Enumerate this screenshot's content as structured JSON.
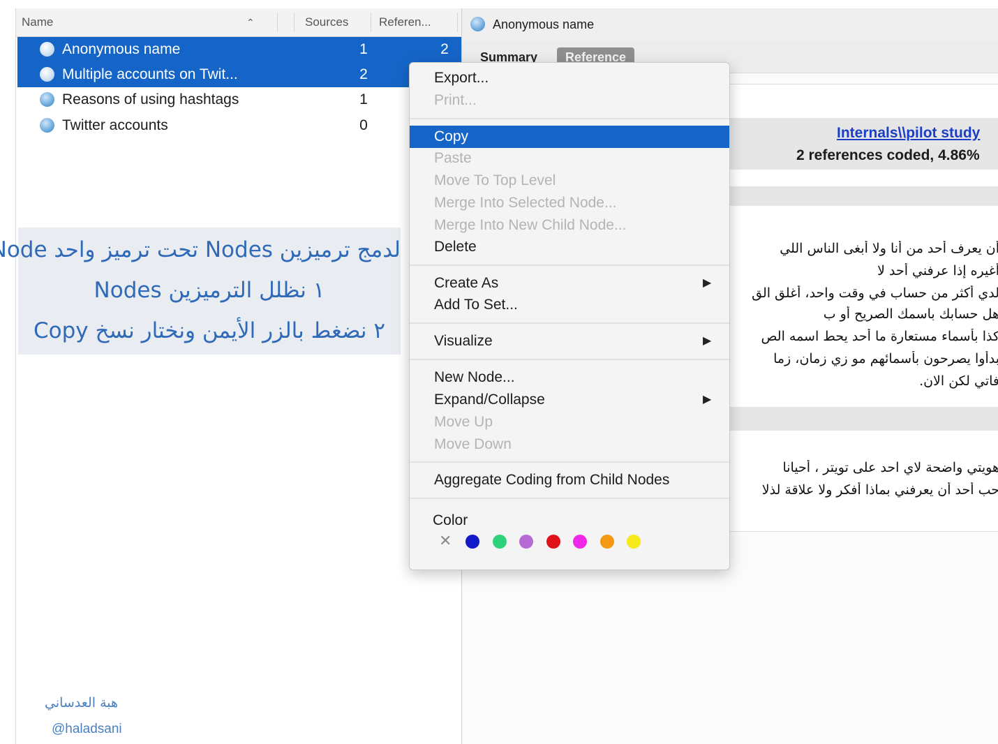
{
  "tree": {
    "headers": {
      "name": "Name",
      "sources": "Sources",
      "references": "Referen..."
    },
    "rows": [
      {
        "name": "Anonymous name",
        "sources": "1",
        "references": "2",
        "selected": true
      },
      {
        "name": "Multiple accounts on Twit...",
        "sources": "2",
        "references": "",
        "selected": true
      },
      {
        "name": "Reasons of using hashtags",
        "sources": "1",
        "references": "",
        "selected": false
      },
      {
        "name": "Twitter accounts",
        "sources": "0",
        "references": "",
        "selected": false
      }
    ]
  },
  "annotation": {
    "line1": "لدمج ترميزين Nodes تحت ترميز واحد Node",
    "line2": "١ نظلل الترميزين Nodes",
    "line3": "٢ نضغط بالزر الأيمن ونختار نسخ Copy",
    "author_name": "هبة العدساني",
    "author_handle": "@haladsani"
  },
  "detail": {
    "title": "Anonymous name",
    "tabs": {
      "summary": "Summary",
      "reference": "Reference"
    },
    "source_link": "Internals\\\\pilot study",
    "coded_summary": "2 references coded, 4.86%",
    "paragraph1": [
      "أن يعرف أحد من أنا ولا أبغى الناس اللي",
      "أغيره إذا عرفني أحد لا",
      "لدي أكثر من حساب في وقت واحد، أغلق الق",
      "هل حسابك باسمك الصريح أو ب",
      "كذا بأسماء مستعارة ما أحد يحط اسمه الص",
      "بدأوا يصرحون بأسمائهم مو زي زمان، زما",
      "فاتي لكن الان."
    ],
    "paragraph2": [
      "هويتي واضحة لاي احد على تويتر ، أحيانا",
      "حب أحد أن يعرفني بماذا أفكر ولا علاقة لذلا"
    ]
  },
  "context_menu": {
    "items": [
      {
        "label": "Export...",
        "enabled": true
      },
      {
        "label": "Print...",
        "enabled": false
      },
      {
        "label": "Copy",
        "enabled": true,
        "highlighted": true
      },
      {
        "label": "Paste",
        "enabled": false
      },
      {
        "label": "Move To Top Level",
        "enabled": false
      },
      {
        "label": "Merge Into Selected Node...",
        "enabled": false
      },
      {
        "label": "Merge Into New Child Node...",
        "enabled": false
      },
      {
        "label": "Delete",
        "enabled": true
      },
      {
        "label": "Create As",
        "enabled": true,
        "submenu": true
      },
      {
        "label": "Add To Set...",
        "enabled": true
      },
      {
        "label": "Visualize",
        "enabled": true,
        "submenu": true
      },
      {
        "label": "New Node...",
        "enabled": true
      },
      {
        "label": "Expand/Collapse",
        "enabled": true,
        "submenu": true
      },
      {
        "label": "Move Up",
        "enabled": false
      },
      {
        "label": "Move Down",
        "enabled": false
      },
      {
        "label": "Aggregate Coding from Child Nodes",
        "enabled": true
      }
    ],
    "color_label": "Color",
    "colors": [
      "#1219c9",
      "#2fd17a",
      "#b56ad6",
      "#e0131a",
      "#ee28e6",
      "#f39a12",
      "#f5ea1c"
    ]
  },
  "icons": {
    "sort": "chevron-up-icon",
    "node": "node-globe-icon",
    "submenu": "triangle-right-icon",
    "no_color": "close-icon"
  },
  "accent_color": "#1565c8"
}
